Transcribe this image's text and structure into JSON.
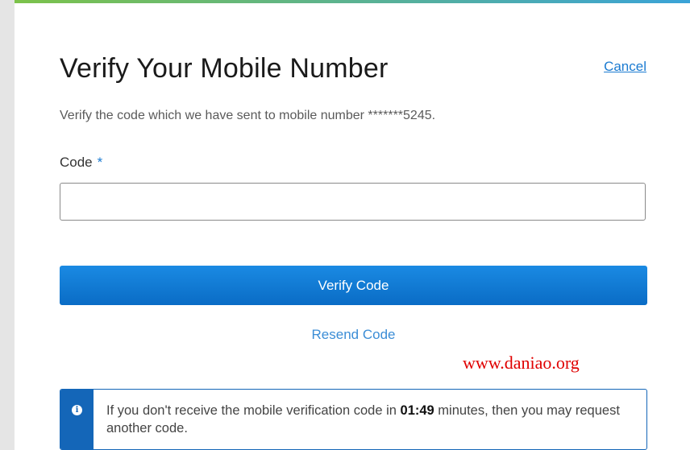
{
  "dialog": {
    "title": "Verify Your Mobile Number",
    "cancel_label": "Cancel",
    "subtitle": "Verify the code which we have sent to mobile number *******5245."
  },
  "form": {
    "code_label": "Code",
    "required_marker": "*",
    "code_value": "",
    "verify_button_label": "Verify Code",
    "resend_label": "Resend Code"
  },
  "watermark": "www.daniao.org",
  "info": {
    "icon": "info-icon",
    "text_before": "If you don't receive the mobile verification code in ",
    "countdown": "01:49",
    "text_after": " minutes, then you may request another code."
  },
  "colors": {
    "accent": "#0a6cc5",
    "link": "#1b7bd1",
    "info_stripe": "#1466b8",
    "watermark": "#e00000"
  }
}
